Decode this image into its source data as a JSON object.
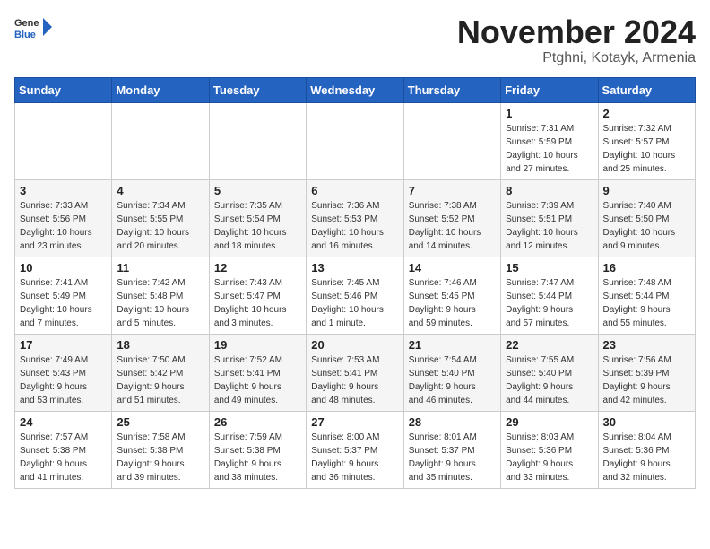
{
  "header": {
    "logo_general": "General",
    "logo_blue": "Blue",
    "title": "November 2024",
    "subtitle": "Ptghni, Kotayk, Armenia"
  },
  "days_of_week": [
    "Sunday",
    "Monday",
    "Tuesday",
    "Wednesday",
    "Thursday",
    "Friday",
    "Saturday"
  ],
  "weeks": [
    [
      {
        "day": "",
        "info": ""
      },
      {
        "day": "",
        "info": ""
      },
      {
        "day": "",
        "info": ""
      },
      {
        "day": "",
        "info": ""
      },
      {
        "day": "",
        "info": ""
      },
      {
        "day": "1",
        "info": "Sunrise: 7:31 AM\nSunset: 5:59 PM\nDaylight: 10 hours\nand 27 minutes."
      },
      {
        "day": "2",
        "info": "Sunrise: 7:32 AM\nSunset: 5:57 PM\nDaylight: 10 hours\nand 25 minutes."
      }
    ],
    [
      {
        "day": "3",
        "info": "Sunrise: 7:33 AM\nSunset: 5:56 PM\nDaylight: 10 hours\nand 23 minutes."
      },
      {
        "day": "4",
        "info": "Sunrise: 7:34 AM\nSunset: 5:55 PM\nDaylight: 10 hours\nand 20 minutes."
      },
      {
        "day": "5",
        "info": "Sunrise: 7:35 AM\nSunset: 5:54 PM\nDaylight: 10 hours\nand 18 minutes."
      },
      {
        "day": "6",
        "info": "Sunrise: 7:36 AM\nSunset: 5:53 PM\nDaylight: 10 hours\nand 16 minutes."
      },
      {
        "day": "7",
        "info": "Sunrise: 7:38 AM\nSunset: 5:52 PM\nDaylight: 10 hours\nand 14 minutes."
      },
      {
        "day": "8",
        "info": "Sunrise: 7:39 AM\nSunset: 5:51 PM\nDaylight: 10 hours\nand 12 minutes."
      },
      {
        "day": "9",
        "info": "Sunrise: 7:40 AM\nSunset: 5:50 PM\nDaylight: 10 hours\nand 9 minutes."
      }
    ],
    [
      {
        "day": "10",
        "info": "Sunrise: 7:41 AM\nSunset: 5:49 PM\nDaylight: 10 hours\nand 7 minutes."
      },
      {
        "day": "11",
        "info": "Sunrise: 7:42 AM\nSunset: 5:48 PM\nDaylight: 10 hours\nand 5 minutes."
      },
      {
        "day": "12",
        "info": "Sunrise: 7:43 AM\nSunset: 5:47 PM\nDaylight: 10 hours\nand 3 minutes."
      },
      {
        "day": "13",
        "info": "Sunrise: 7:45 AM\nSunset: 5:46 PM\nDaylight: 10 hours\nand 1 minute."
      },
      {
        "day": "14",
        "info": "Sunrise: 7:46 AM\nSunset: 5:45 PM\nDaylight: 9 hours\nand 59 minutes."
      },
      {
        "day": "15",
        "info": "Sunrise: 7:47 AM\nSunset: 5:44 PM\nDaylight: 9 hours\nand 57 minutes."
      },
      {
        "day": "16",
        "info": "Sunrise: 7:48 AM\nSunset: 5:44 PM\nDaylight: 9 hours\nand 55 minutes."
      }
    ],
    [
      {
        "day": "17",
        "info": "Sunrise: 7:49 AM\nSunset: 5:43 PM\nDaylight: 9 hours\nand 53 minutes."
      },
      {
        "day": "18",
        "info": "Sunrise: 7:50 AM\nSunset: 5:42 PM\nDaylight: 9 hours\nand 51 minutes."
      },
      {
        "day": "19",
        "info": "Sunrise: 7:52 AM\nSunset: 5:41 PM\nDaylight: 9 hours\nand 49 minutes."
      },
      {
        "day": "20",
        "info": "Sunrise: 7:53 AM\nSunset: 5:41 PM\nDaylight: 9 hours\nand 48 minutes."
      },
      {
        "day": "21",
        "info": "Sunrise: 7:54 AM\nSunset: 5:40 PM\nDaylight: 9 hours\nand 46 minutes."
      },
      {
        "day": "22",
        "info": "Sunrise: 7:55 AM\nSunset: 5:40 PM\nDaylight: 9 hours\nand 44 minutes."
      },
      {
        "day": "23",
        "info": "Sunrise: 7:56 AM\nSunset: 5:39 PM\nDaylight: 9 hours\nand 42 minutes."
      }
    ],
    [
      {
        "day": "24",
        "info": "Sunrise: 7:57 AM\nSunset: 5:38 PM\nDaylight: 9 hours\nand 41 minutes."
      },
      {
        "day": "25",
        "info": "Sunrise: 7:58 AM\nSunset: 5:38 PM\nDaylight: 9 hours\nand 39 minutes."
      },
      {
        "day": "26",
        "info": "Sunrise: 7:59 AM\nSunset: 5:38 PM\nDaylight: 9 hours\nand 38 minutes."
      },
      {
        "day": "27",
        "info": "Sunrise: 8:00 AM\nSunset: 5:37 PM\nDaylight: 9 hours\nand 36 minutes."
      },
      {
        "day": "28",
        "info": "Sunrise: 8:01 AM\nSunset: 5:37 PM\nDaylight: 9 hours\nand 35 minutes."
      },
      {
        "day": "29",
        "info": "Sunrise: 8:03 AM\nSunset: 5:36 PM\nDaylight: 9 hours\nand 33 minutes."
      },
      {
        "day": "30",
        "info": "Sunrise: 8:04 AM\nSunset: 5:36 PM\nDaylight: 9 hours\nand 32 minutes."
      }
    ]
  ]
}
